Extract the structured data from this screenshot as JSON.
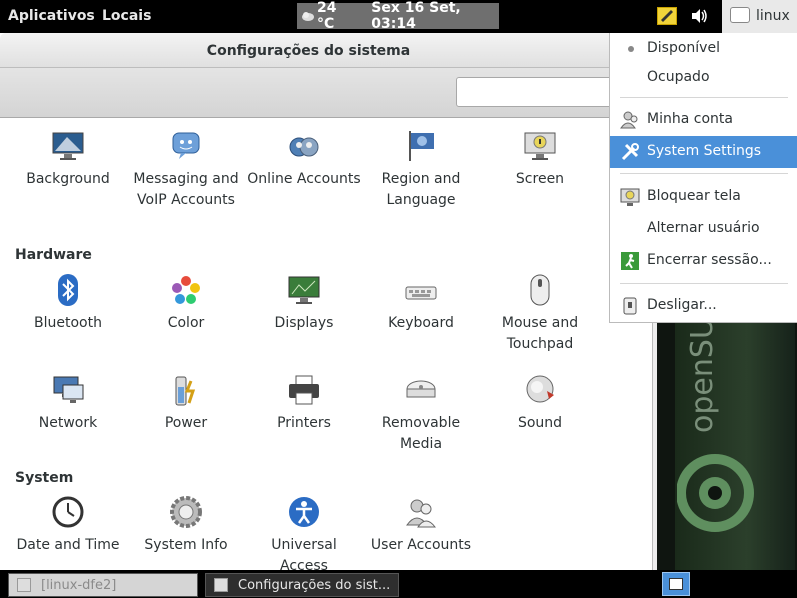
{
  "top_panel": {
    "apps_menu": "Aplicativos",
    "places_menu": "Locais",
    "weather": "24 °C",
    "datetime": "Sex 16 Set, 03:14",
    "user": "linux"
  },
  "window": {
    "title": "Configurações do sistema",
    "search": {
      "value": "",
      "placeholder": ""
    },
    "personal": [
      {
        "label": "Background",
        "icon": "background-icon"
      },
      {
        "label": "Messaging and VoIP Accounts",
        "icon": "messaging-icon"
      },
      {
        "label": "Online Accounts",
        "icon": "online-accounts-icon"
      },
      {
        "label": "Region and Language",
        "icon": "region-flag-icon"
      },
      {
        "label": "Screen",
        "icon": "screen-lock-icon"
      }
    ],
    "hardware": {
      "heading": "Hardware",
      "items": [
        {
          "label": "Bluetooth",
          "icon": "bluetooth-icon"
        },
        {
          "label": "Color",
          "icon": "color-icon"
        },
        {
          "label": "Displays",
          "icon": "displays-icon"
        },
        {
          "label": "Keyboard",
          "icon": "keyboard-icon"
        },
        {
          "label": "Mouse and Touchpad",
          "icon": "mouse-icon"
        },
        {
          "label": "Network",
          "icon": "network-icon"
        },
        {
          "label": "Power",
          "icon": "power-icon"
        },
        {
          "label": "Printers",
          "icon": "printer-icon"
        },
        {
          "label": "Removable Media",
          "icon": "removable-media-icon"
        },
        {
          "label": "Sound",
          "icon": "sound-icon"
        }
      ]
    },
    "system": {
      "heading": "System",
      "items": [
        {
          "label": "Date and Time",
          "icon": "clock-icon"
        },
        {
          "label": "System Info",
          "icon": "gear-icon"
        },
        {
          "label": "Universal Access",
          "icon": "accessibility-icon"
        },
        {
          "label": "User Accounts",
          "icon": "users-icon"
        }
      ]
    }
  },
  "user_menu": {
    "available": "Disponível",
    "busy": "Ocupado",
    "my_account": "Minha conta",
    "system_settings": "System Settings",
    "lock_screen": "Bloquear tela",
    "switch_user": "Alternar usuário",
    "log_out": "Encerrar sessão...",
    "power_off": "Desligar..."
  },
  "desktop": {
    "brand": "openSUSE"
  },
  "taskbar": {
    "tasks": [
      {
        "label": "[linux-dfe2]",
        "icon": "terminal-icon"
      },
      {
        "label": "Configurações do sist...",
        "icon": "settings-window-icon"
      }
    ]
  },
  "colors": {
    "accent": "#4a90d9",
    "panel": "#000000",
    "highlight": "#6f6f6f"
  }
}
